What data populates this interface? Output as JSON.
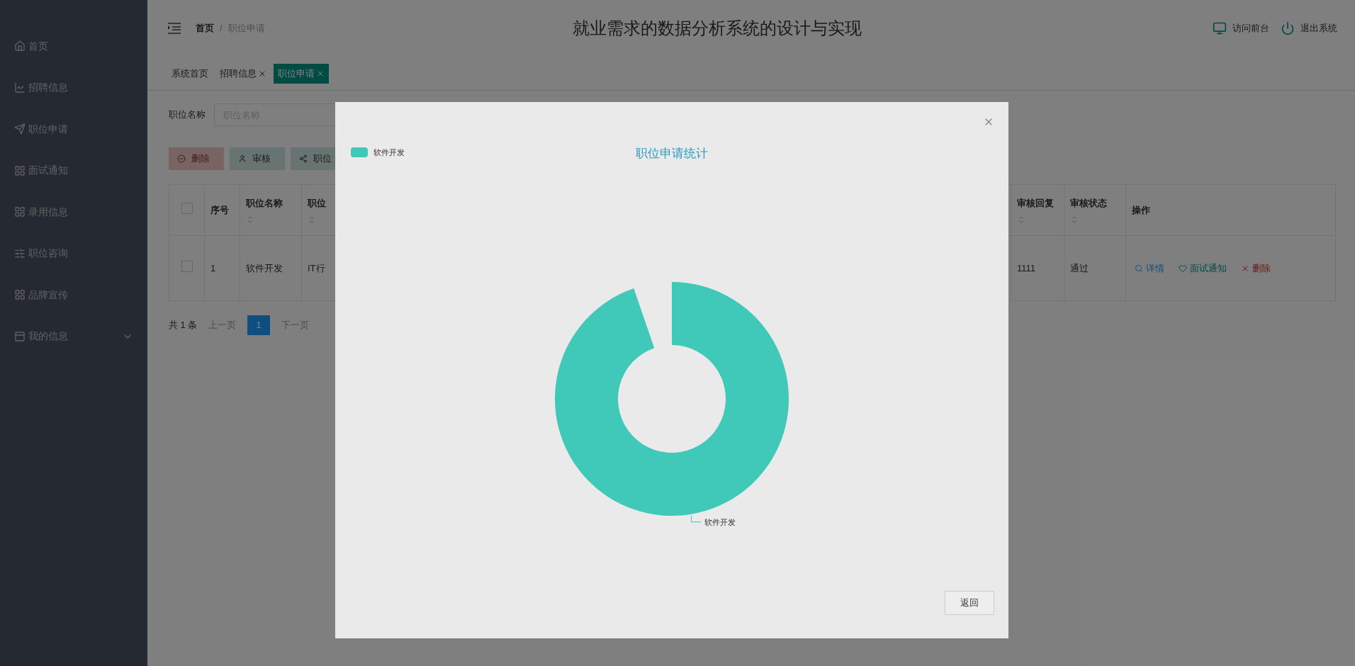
{
  "sidebar": {
    "items": [
      {
        "label": "首页",
        "kind": "link"
      },
      {
        "label": "招聘信息",
        "kind": "link"
      },
      {
        "label": "职位申请",
        "kind": "link"
      },
      {
        "label": "面试通知",
        "kind": "link"
      },
      {
        "label": "录用信息",
        "kind": "link"
      },
      {
        "label": "职位咨询",
        "kind": "link"
      },
      {
        "label": "品牌宣传",
        "kind": "link"
      },
      {
        "label": "我的信息",
        "kind": "group"
      }
    ]
  },
  "header": {
    "breadcrumb": [
      "首页",
      "职位申请"
    ],
    "separator": "/",
    "title": "就业需求的数据分析系统的设计与实现",
    "actions": [
      "访问前台",
      "退出系统"
    ]
  },
  "tabs": [
    {
      "label": "系统首页",
      "closable": false,
      "selected": false
    },
    {
      "label": "招聘信息",
      "closable": true,
      "selected": false
    },
    {
      "label": "职位申请",
      "closable": true,
      "selected": true
    }
  ],
  "search": {
    "label": "职位名称",
    "placeholder": "职位名称"
  },
  "toolbar": [
    {
      "label": "删除",
      "kind": "danger"
    },
    {
      "label": "审核",
      "kind": "audit"
    },
    {
      "label": "职位",
      "kind": "chart"
    }
  ],
  "table": {
    "header_checked": false,
    "columns": [
      {
        "label": "序号",
        "sortable": false
      },
      {
        "label": "职位名称",
        "sortable": true
      },
      {
        "label": "职位",
        "sortable": true
      },
      {
        "label": "审核回复",
        "sortable": true
      },
      {
        "label": "审核状态",
        "sortable": true
      },
      {
        "label": "操作",
        "sortable": false
      }
    ],
    "rows": [
      {
        "checked": false,
        "cells": [
          "1",
          "软件开发",
          "IT行",
          "1111",
          "通过"
        ],
        "actions": [
          {
            "label": "详情",
            "kind": "detail"
          },
          {
            "label": "面试通知",
            "kind": "notify"
          },
          {
            "label": "删除",
            "kind": "delete"
          }
        ]
      }
    ]
  },
  "pagination": {
    "total": "共 1 条",
    "prev": "上一页",
    "pages": [
      {
        "label": "1",
        "selected": true
      }
    ],
    "next": "下一页"
  },
  "modal": {
    "chart_data": {
      "type": "donut",
      "title": "职位申请统计",
      "categories": [
        "软件开发"
      ]
    },
    "button": "返回"
  }
}
